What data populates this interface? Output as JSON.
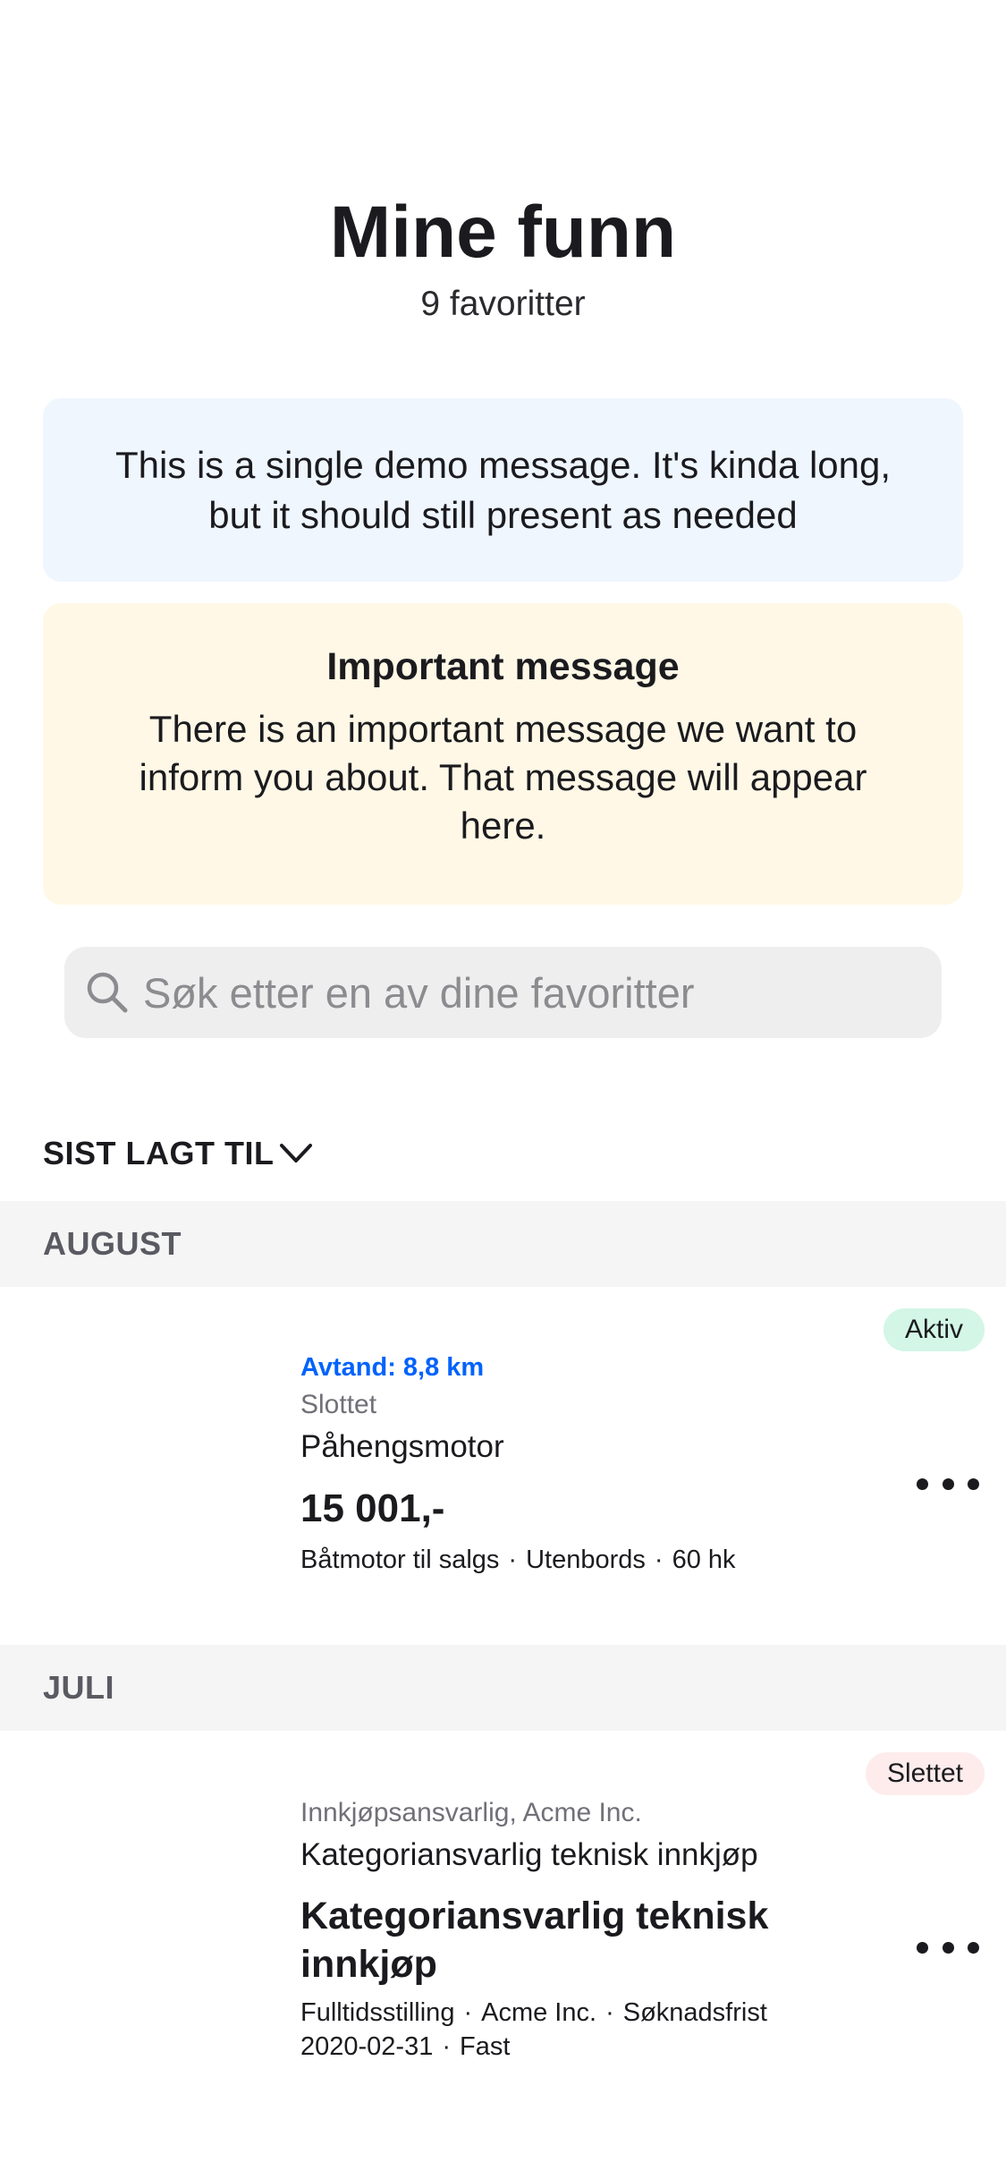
{
  "header": {
    "title": "Mine funn",
    "subtitle": "9 favoritter"
  },
  "info_message": {
    "text": "This is a single demo message. It's kinda long, but it should still present as needed"
  },
  "important_message": {
    "title": "Important message",
    "text": "There is an important message we want to inform you about. That message will appear here."
  },
  "search": {
    "placeholder": "Søk etter en av dine favoritter",
    "value": "",
    "icon": "search-icon"
  },
  "sort": {
    "label": "SIST LAGT TIL",
    "icon": "chevron-down-icon"
  },
  "sections": [
    {
      "month": "AUGUST",
      "items": [
        {
          "status": "Aktiv",
          "distance": "Avtand: 8,8 km",
          "location": "Slottet",
          "heading": "Påhengsmotor",
          "price": "15 001,-",
          "meta": [
            "Båtmotor til salgs",
            "Utenbords",
            "60 hk"
          ]
        }
      ]
    },
    {
      "month": "JULI",
      "items": [
        {
          "status": "Slettet",
          "company": "Innkjøpsansvarlig, Acme Inc.",
          "subheading": "Kategoriansvarlig teknisk innkjøp",
          "title": "Kategoriansvarlig teknisk innkjøp",
          "meta_line1": [
            "Fulltidsstilling",
            "Acme Inc.",
            "Søknadsfrist"
          ],
          "meta_line2": [
            "2020-02-31",
            "Fast"
          ]
        }
      ]
    }
  ],
  "colors": {
    "info_bg": "#eff6fe",
    "warning_bg": "#fff8e6",
    "active_badge": "#d3f6e6",
    "deleted_badge": "#feecec",
    "link": "#0063fb"
  }
}
